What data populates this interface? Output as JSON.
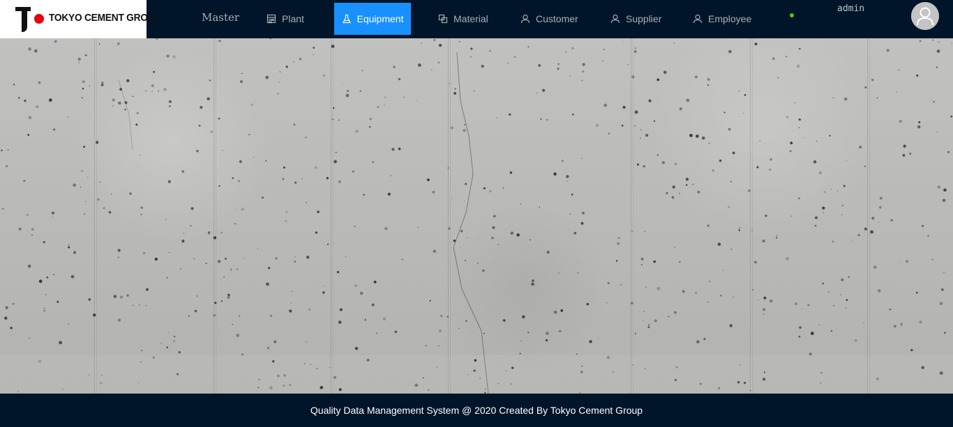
{
  "header": {
    "logo_text": "TOKYO CEMENT GROUP",
    "nav": [
      {
        "label": "Master",
        "icon": "none"
      },
      {
        "label": "Plant",
        "icon": "shop-icon"
      },
      {
        "label": "Equipment",
        "icon": "flask-icon",
        "active": true
      },
      {
        "label": "Material",
        "icon": "block-icon"
      },
      {
        "label": "Customer",
        "icon": "user-icon"
      },
      {
        "label": "Supplier",
        "icon": "user-icon"
      },
      {
        "label": "Employee",
        "icon": "user-icon"
      }
    ],
    "status_color": "#52c41a",
    "username": "admin",
    "avatar_icon": "user-avatar-icon"
  },
  "content": {
    "background": "concrete-texture"
  },
  "footer": {
    "text": "Quality Data Management System @ 2020 Created By Tokyo Cement Group"
  },
  "colors": {
    "header_bg": "#001529",
    "accent": "#1890ff",
    "logo_dot": "#e60012"
  }
}
